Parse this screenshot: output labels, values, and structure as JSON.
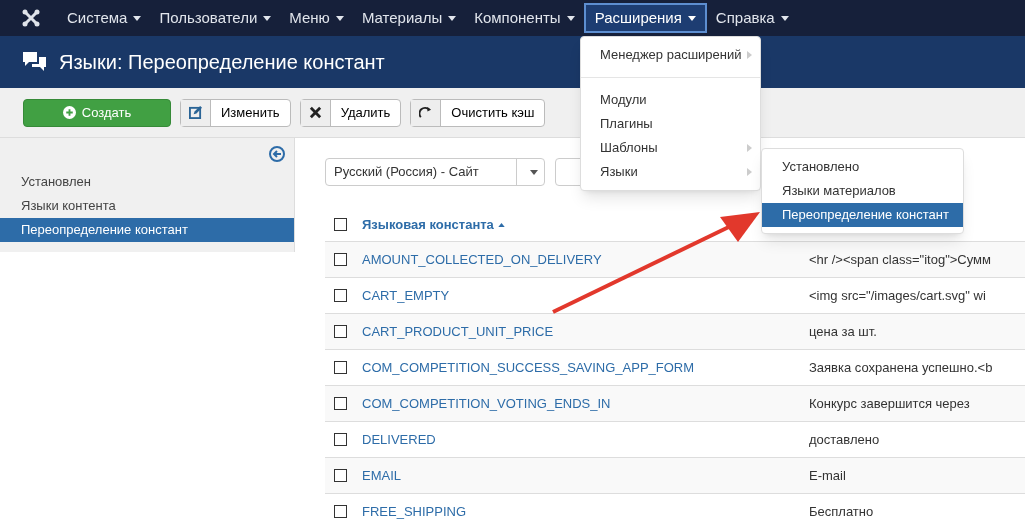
{
  "navbar": {
    "items": [
      {
        "label": "Система",
        "open": false
      },
      {
        "label": "Пользователи",
        "open": false
      },
      {
        "label": "Меню",
        "open": false
      },
      {
        "label": "Материалы",
        "open": false
      },
      {
        "label": "Компоненты",
        "open": false
      },
      {
        "label": "Расширения",
        "open": true
      },
      {
        "label": "Справка",
        "open": false
      }
    ]
  },
  "menu": {
    "items": [
      {
        "kind": "item",
        "label": "Менеджер расширений",
        "submenu": true
      },
      {
        "kind": "divider"
      },
      {
        "kind": "item",
        "label": "Модули",
        "submenu": false
      },
      {
        "kind": "item",
        "label": "Плагины",
        "submenu": false
      },
      {
        "kind": "item",
        "label": "Шаблоны",
        "submenu": true
      },
      {
        "kind": "item",
        "label": "Языки",
        "submenu": true
      }
    ]
  },
  "submenu": {
    "items": [
      {
        "label": "Установлено",
        "selected": false
      },
      {
        "label": "Языки материалов",
        "selected": false
      },
      {
        "label": "Переопределение констант",
        "selected": true
      }
    ]
  },
  "page_title": "Языки: Переопределение констант",
  "toolbar": [
    {
      "kind": "create",
      "label": "Создать"
    },
    {
      "kind": "edit",
      "label": "Изменить"
    },
    {
      "kind": "delete",
      "label": "Удалить"
    },
    {
      "kind": "refresh",
      "label": "Очистить кэш"
    }
  ],
  "sidebar": {
    "items": [
      {
        "label": "Установлен",
        "selected": false
      },
      {
        "label": "Языки контента",
        "selected": false
      },
      {
        "label": "Переопределение констант",
        "selected": true
      }
    ]
  },
  "filter": {
    "value": "Русский (Россия) - Сайт"
  },
  "table": {
    "column_1": "Языковая константа",
    "select_all_checked": false,
    "rows": [
      {
        "constant": "AMOUNT_COLLECTED_ON_DELIVERY",
        "value": "<hr /><span class=\"itog\">Сумм",
        "checked": false
      },
      {
        "constant": "CART_EMPTY",
        "value": "<img src=\"/images/cart.svg\" wi",
        "checked": false
      },
      {
        "constant": "CART_PRODUCT_UNIT_PRICE",
        "value": "цена за шт.",
        "checked": false
      },
      {
        "constant": "COM_COMPETITION_SUCCESS_SAVING_APP_FORM",
        "value": "Заявка сохранена успешно.<b",
        "checked": false
      },
      {
        "constant": "COM_COMPETITION_VOTING_ENDS_IN",
        "value": "Конкурс завершится через",
        "checked": false
      },
      {
        "constant": "DELIVERED",
        "value": "доставлено",
        "checked": false
      },
      {
        "constant": "EMAIL",
        "value": "E-mail",
        "checked": false
      },
      {
        "constant": "FREE_SHIPPING",
        "value": "Бесплатно",
        "checked": false
      }
    ]
  }
}
